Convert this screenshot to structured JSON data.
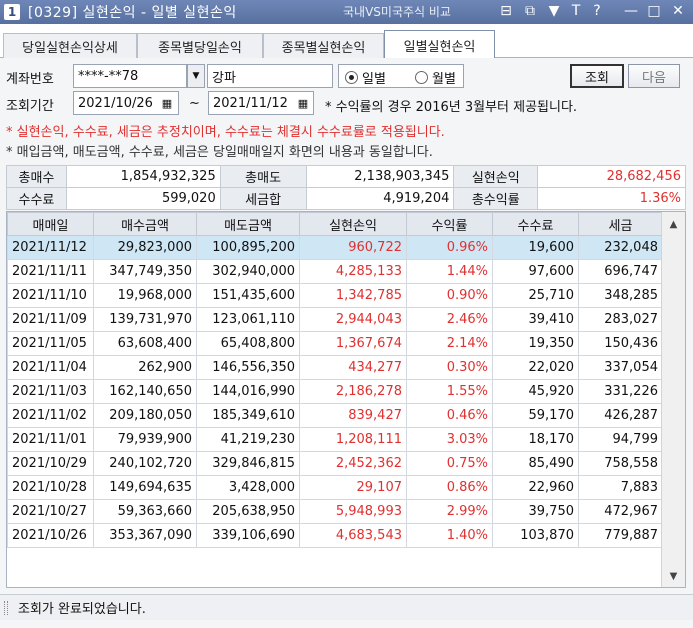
{
  "window": {
    "number": "1",
    "title": "[0329] 실현손익 - 일별 실현손익",
    "compare_label": "국내VS미국주식 비교",
    "controls": [
      "⊟",
      "⧉",
      "▼",
      "T",
      "?",
      "—",
      "□",
      "✕"
    ]
  },
  "tabs": [
    {
      "label": "당일실현손익상세"
    },
    {
      "label": "종목별당일손익"
    },
    {
      "label": "종목별실현손익"
    },
    {
      "label": "일별실현손익"
    }
  ],
  "form": {
    "account_label": "계좌번호",
    "account_value": "****-**78",
    "account_name": "강파",
    "radio_daily": "일별",
    "radio_monthly": "월별",
    "search_button": "조회",
    "next_button": "다음",
    "period_label": "조회기간",
    "date_from": "2021/10/26",
    "date_to": "2021/11/12",
    "tilde": "~",
    "period_note": "* 수익률의 경우 2016년 3월부터 제공됩니다."
  },
  "notices": {
    "red": "* 실현손익, 수수료, 세금은 추정치이며, 수수료는 체결시 수수료률로 적용됩니다.",
    "gray": "* 매입금액, 매도금액, 수수료, 세금은 당일매매일지 화면의 내용과 동일합니다."
  },
  "summary": {
    "total_buy_label": "총매수",
    "total_buy": "1,854,932,325",
    "total_sell_label": "총매도",
    "total_sell": "2,138,903,345",
    "realized_label": "실현손익",
    "realized": "28,682,456",
    "fee_label": "수수료",
    "fee": "599,020",
    "tax_label": "세금합",
    "tax": "4,919,204",
    "return_label": "총수익률",
    "return": "1.36%"
  },
  "grid": {
    "headers": [
      "매매일",
      "매수금액",
      "매도금액",
      "실현손익",
      "수익률",
      "수수료",
      "세금"
    ],
    "rows": [
      [
        "2021/11/12",
        "29,823,000",
        "100,895,200",
        "960,722",
        "0.96%",
        "19,600",
        "232,048"
      ],
      [
        "2021/11/11",
        "347,749,350",
        "302,940,000",
        "4,285,133",
        "1.44%",
        "97,600",
        "696,747"
      ],
      [
        "2021/11/10",
        "19,968,000",
        "151,435,600",
        "1,342,785",
        "0.90%",
        "25,710",
        "348,285"
      ],
      [
        "2021/11/09",
        "139,731,970",
        "123,061,110",
        "2,944,043",
        "2.46%",
        "39,410",
        "283,027"
      ],
      [
        "2021/11/05",
        "63,608,400",
        "65,408,800",
        "1,367,674",
        "2.14%",
        "19,350",
        "150,436"
      ],
      [
        "2021/11/04",
        "262,900",
        "146,556,350",
        "434,277",
        "0.30%",
        "22,020",
        "337,054"
      ],
      [
        "2021/11/03",
        "162,140,650",
        "144,016,990",
        "2,186,278",
        "1.55%",
        "45,920",
        "331,226"
      ],
      [
        "2021/11/02",
        "209,180,050",
        "185,349,610",
        "839,427",
        "0.46%",
        "59,170",
        "426,287"
      ],
      [
        "2021/11/01",
        "79,939,900",
        "41,219,230",
        "1,208,111",
        "3.03%",
        "18,170",
        "94,799"
      ],
      [
        "2021/10/29",
        "240,102,720",
        "329,846,815",
        "2,452,362",
        "0.75%",
        "85,490",
        "758,558"
      ],
      [
        "2021/10/28",
        "149,694,635",
        "3,428,000",
        "29,107",
        "0.86%",
        "22,960",
        "7,883"
      ],
      [
        "2021/10/27",
        "59,363,660",
        "205,638,950",
        "5,948,993",
        "2.99%",
        "39,750",
        "472,967"
      ],
      [
        "2021/10/26",
        "353,367,090",
        "339,106,690",
        "4,683,543",
        "1.40%",
        "103,870",
        "779,887"
      ]
    ]
  },
  "status": {
    "message": "조회가 완료되었습니다."
  },
  "colors": {
    "positive": "#e03030",
    "selected_row": "#cfe7f5",
    "titlebar": "#56709f"
  }
}
